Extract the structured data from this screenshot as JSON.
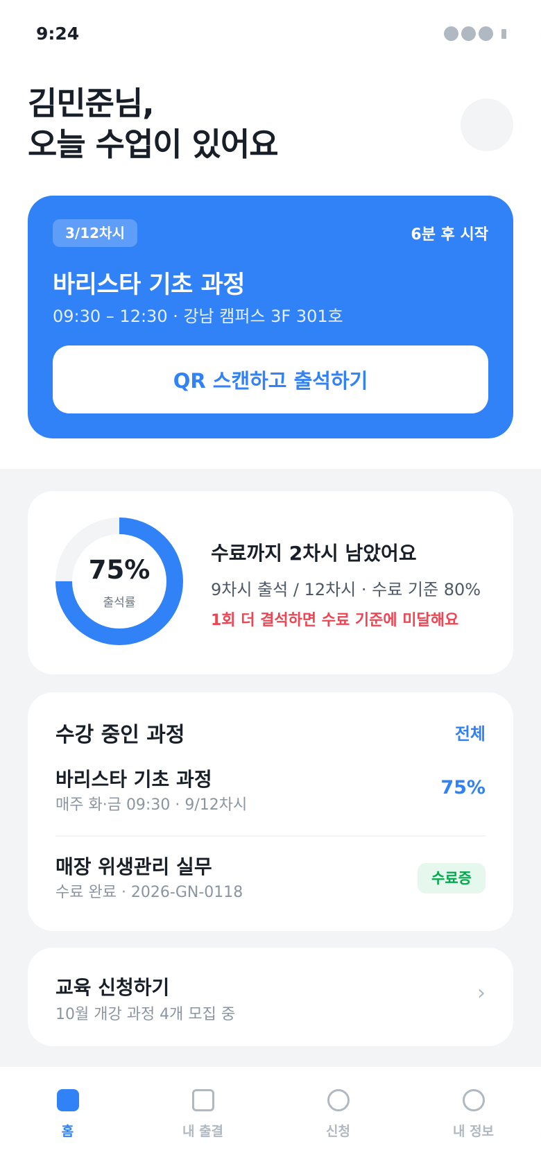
{
  "status_bar": {
    "time": "9:24"
  },
  "greeting": {
    "line1": "김민준님,",
    "line2": "오늘 수업이 있어요"
  },
  "today_class": {
    "session_badge": "3/12차시",
    "starts_in": "6분 후 시작",
    "title": "바리스타 기초 과정",
    "meta": "09:30 – 12:30 · 강남 캠퍼스 3F 301호",
    "qr_button": "QR 스캔하고 출석하기"
  },
  "attendance": {
    "rate_text": "75%",
    "rate_value": 0.75,
    "rate_label": "출석률",
    "title": "수료까지 2차시 남았어요",
    "detail": "9차시 출석 / 12차시 · 수료 기준 80%",
    "warning": "1회 더 결석하면 수료 기준에 미달해요"
  },
  "courses": {
    "title": "수강 중인 과정",
    "see_all": "전체",
    "items": [
      {
        "name": "바리스타 기초 과정",
        "sub": "매주 화·금 09:30 · 9/12차시",
        "progress": "75%"
      },
      {
        "name": "매장 위생관리 실무",
        "sub": "수료 완료 · 2026-GN-0118",
        "badge": "수료증"
      }
    ]
  },
  "apply": {
    "title": "교육 신청하기",
    "sub": "10월 개강 과정 4개 모집 중",
    "chevron": "›"
  },
  "tabs": [
    {
      "label": "홈",
      "icon": "home-icon",
      "active": true
    },
    {
      "label": "내 출결",
      "icon": "attendance-icon",
      "active": false
    },
    {
      "label": "신청",
      "icon": "apply-icon",
      "active": false
    },
    {
      "label": "내 정보",
      "icon": "profile-icon",
      "active": false
    }
  ],
  "colors": {
    "primary": "#3182f6",
    "danger": "#f04452",
    "success": "#03a94d",
    "background": "#f2f4f6",
    "text": "#191f28"
  }
}
